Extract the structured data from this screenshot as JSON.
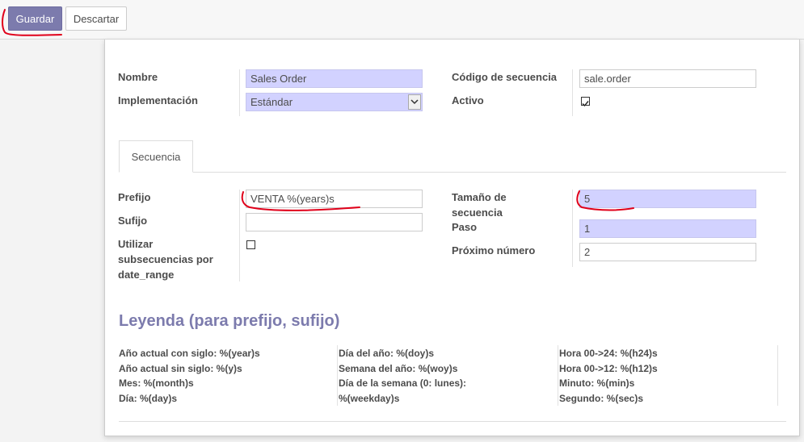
{
  "toolbar": {
    "save_label": "Guardar",
    "discard_label": "Descartar"
  },
  "form": {
    "name_label": "Nombre",
    "name_value": "Sales Order",
    "implementation_label": "Implementación",
    "implementation_value": "Estándar",
    "code_label": "Código de secuencia",
    "code_value": "sale.order",
    "active_label": "Activo",
    "active_checked": true
  },
  "tabs": [
    {
      "label": "Secuencia"
    }
  ],
  "sequence": {
    "prefix_label": "Prefijo",
    "prefix_value": "VENTA %(years)s",
    "suffix_label": "Sufijo",
    "suffix_value": "",
    "subseq_label_1": "Utilizar",
    "subseq_label_2": "subsecuencias por",
    "subseq_label_3": "date_range",
    "subseq_checked": false,
    "size_label_1": "Tamaño de",
    "size_label_2": "secuencia",
    "size_value": "5",
    "step_label": "Paso",
    "step_value": "1",
    "next_label": "Próximo número",
    "next_value": "2"
  },
  "legend": {
    "title": "Leyenda (para prefijo, sufijo)",
    "col1": [
      "Año actual con siglo: %(year)s",
      "Año actual sin siglo: %(y)s",
      "Mes: %(month)s",
      "Día: %(day)s"
    ],
    "col2": [
      "Día del año: %(doy)s",
      "Semana del año: %(woy)s",
      "Día de la semana (0: lunes):",
      "%(weekday)s"
    ],
    "col3": [
      "Hora 00->24: %(h24)s",
      "Hora 00->12: %(h12)s",
      "Minuto: %(min)s",
      "Segundo: %(sec)s"
    ]
  },
  "colors": {
    "primary": "#7c7bad",
    "required_field": "#d2d2ff",
    "annotation": "#e0001a"
  }
}
